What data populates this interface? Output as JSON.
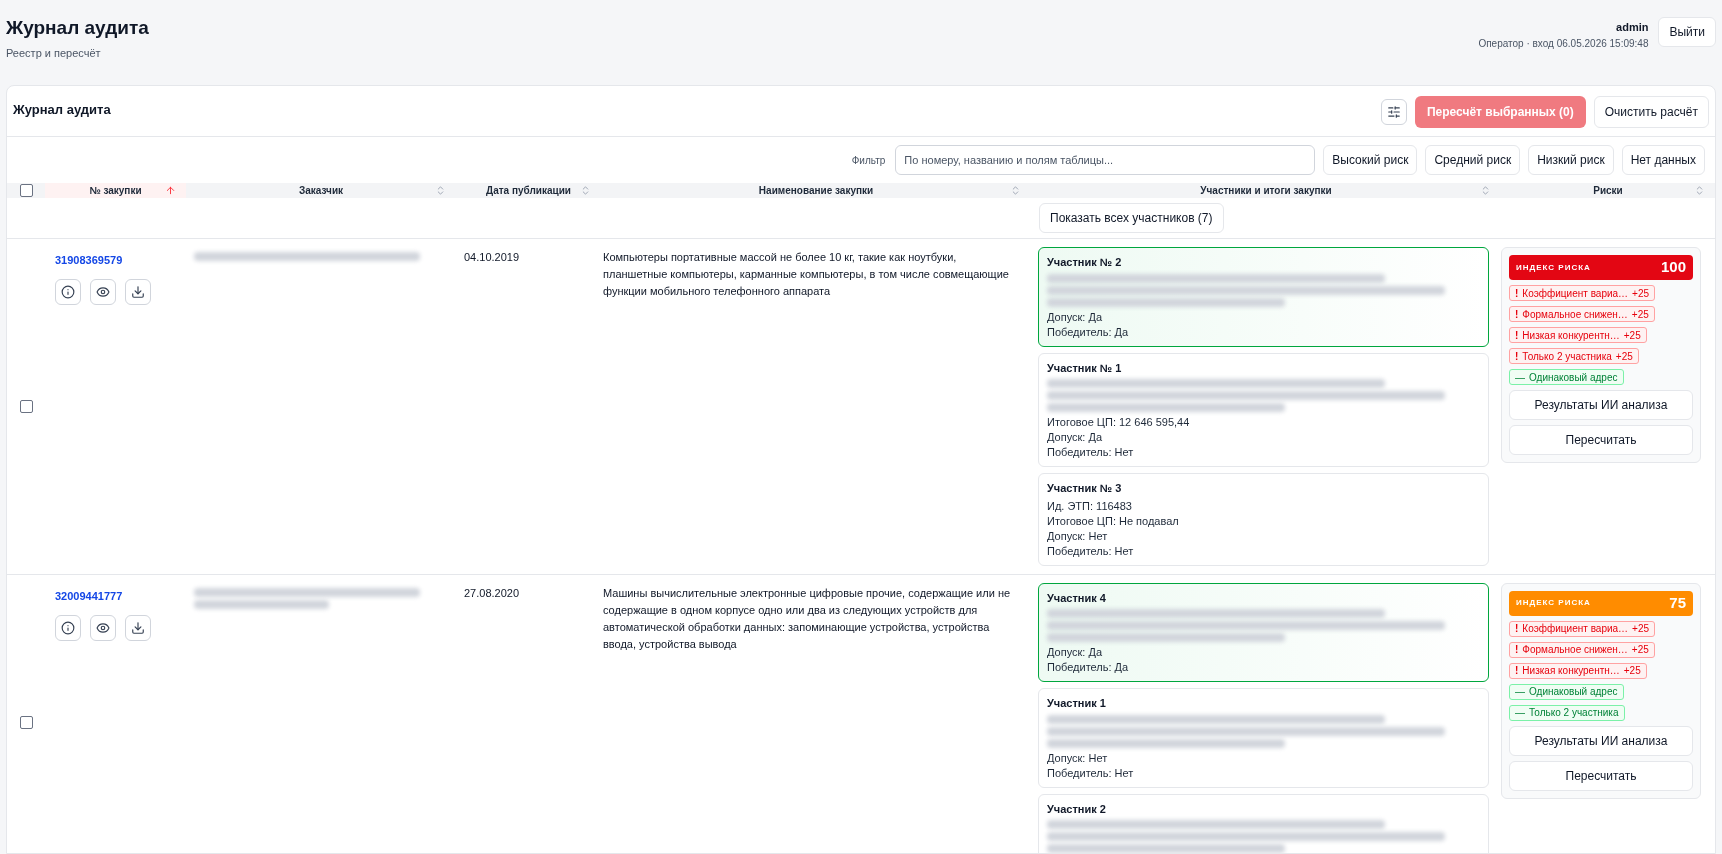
{
  "header": {
    "title": "Журнал аудита",
    "subtitle": "Реестр и пересчёт",
    "user": "admin",
    "session": "Оператор · вход 06.05.2026 15:09:48",
    "logout": "Выйти"
  },
  "card": {
    "title": "Журнал аудита",
    "recalc_selected": "Пересчёт выбранных (0)",
    "recalc_disabled": true,
    "clear": "Очистить расчёт"
  },
  "filter": {
    "label": "Фильтр",
    "placeholder": "По номеру, названию и полям таблицы...",
    "chips": [
      {
        "label": "Высокий риск",
        "selected": false
      },
      {
        "label": "Средний риск",
        "selected": false
      },
      {
        "label": "Низкий риск",
        "selected": false
      },
      {
        "label": "Нет данных",
        "selected": false
      }
    ]
  },
  "table": {
    "select_all_checked": false,
    "columns": [
      {
        "label": "№ закупки",
        "sorted": true
      },
      {
        "label": "Заказчик",
        "sorted": false
      },
      {
        "label": "Дата публикации",
        "sorted": false
      },
      {
        "label": "Наименование закупки",
        "sorted": false
      },
      {
        "label": "Участники и итоги закупки",
        "sorted": false
      },
      {
        "label": "Риски",
        "sorted": false
      }
    ],
    "show_all": "Показать всех участников (7)",
    "rows": [
      {
        "checked": false,
        "number": "31908369579",
        "customer_lines": [
          {
            "kind": "redacted"
          }
        ],
        "date": "04.10.2019",
        "name": "Компьютеры портативные массой не более 10 кг, такие как ноутбуки, планшетные компьютеры, карманные компьютеры, в том числе совмещающие функции мобильного телефонного аппарата",
        "participants": [
          {
            "title": "Участник № 2",
            "winner": true,
            "lines": [
              {
                "kind": "redacted"
              },
              {
                "kind": "redacted"
              },
              {
                "kind": "redacted"
              },
              {
                "kind": "text",
                "text": "Допуск: Да"
              },
              {
                "kind": "text",
                "text": "Победитель: Да"
              }
            ]
          },
          {
            "title": "Участник № 1",
            "winner": false,
            "lines": [
              {
                "kind": "redacted"
              },
              {
                "kind": "redacted"
              },
              {
                "kind": "redacted"
              },
              {
                "kind": "text",
                "text": "Итоговое ЦП: 12 646 595,44"
              },
              {
                "kind": "text",
                "text": "Допуск: Да"
              },
              {
                "kind": "text",
                "text": "Победитель: Нет"
              }
            ]
          },
          {
            "title": "Участник № 3",
            "winner": false,
            "lines": [
              {
                "kind": "text",
                "text": "Ид. ЭТП: 116483"
              },
              {
                "kind": "text",
                "text": "Итоговое ЦП: Не подавал"
              },
              {
                "kind": "text",
                "text": "Допуск: Нет"
              },
              {
                "kind": "text",
                "text": "Победитель: Нет"
              }
            ]
          }
        ],
        "risk": {
          "label": "ИНДЕКС РИСКА",
          "score": "100",
          "color": "#e30613",
          "tags": [
            {
              "kind": "risk",
              "mark": "!",
              "text": "Коэффициент вариа…",
              "points": "+25"
            },
            {
              "kind": "risk",
              "mark": "!",
              "text": "Формальное снижен…",
              "points": "+25"
            },
            {
              "kind": "risk",
              "mark": "!",
              "text": "Низкая конкурентн…",
              "points": "+25"
            },
            {
              "kind": "risk",
              "mark": "!",
              "text": "Только 2 участника",
              "points": "+25"
            },
            {
              "kind": "ok",
              "mark": "—",
              "text": "Одинаковый адрес"
            }
          ],
          "ai": "Результаты ИИ анализа",
          "recalc": "Пересчитать"
        }
      },
      {
        "checked": false,
        "number": "32009441777",
        "customer_lines": [
          {
            "kind": "redacted"
          },
          {
            "kind": "redacted"
          }
        ],
        "date": "27.08.2020",
        "name": "Машины вычислительные электронные цифровые прочие, содержащие или не содержащие в одном корпусе одно или два из следующих устройств для автоматической обработки данных: запоминающие устройства, устройства ввода, устройства вывода",
        "participants": [
          {
            "title": "Участник 4",
            "winner": true,
            "lines": [
              {
                "kind": "redacted"
              },
              {
                "kind": "redacted"
              },
              {
                "kind": "redacted"
              },
              {
                "kind": "text",
                "text": "Допуск: Да"
              },
              {
                "kind": "text",
                "text": "Победитель: Да"
              }
            ]
          },
          {
            "title": "Участник 1",
            "winner": false,
            "lines": [
              {
                "kind": "redacted"
              },
              {
                "kind": "redacted"
              },
              {
                "kind": "redacted"
              },
              {
                "kind": "text",
                "text": "Допуск: Нет"
              },
              {
                "kind": "text",
                "text": "Победитель: Нет"
              }
            ]
          },
          {
            "title": "Участник 2",
            "winner": false,
            "lines": [
              {
                "kind": "redacted"
              },
              {
                "kind": "redacted"
              },
              {
                "kind": "redacted"
              }
            ]
          }
        ],
        "risk": {
          "label": "ИНДЕКС РИСКА",
          "score": "75",
          "color": "#ff8c00",
          "tags": [
            {
              "kind": "risk",
              "mark": "!",
              "text": "Коэффициент вариа…",
              "points": "+25"
            },
            {
              "kind": "risk",
              "mark": "!",
              "text": "Формальное снижен…",
              "points": "+25"
            },
            {
              "kind": "risk",
              "mark": "!",
              "text": "Низкая конкурентн…",
              "points": "+25"
            },
            {
              "kind": "ok",
              "mark": "—",
              "text": "Одинаковый адрес"
            },
            {
              "kind": "ok",
              "mark": "—",
              "text": "Только 2 участника"
            }
          ],
          "ai": "Результаты ИИ анализа",
          "recalc": "Пересчитать"
        }
      }
    ]
  }
}
